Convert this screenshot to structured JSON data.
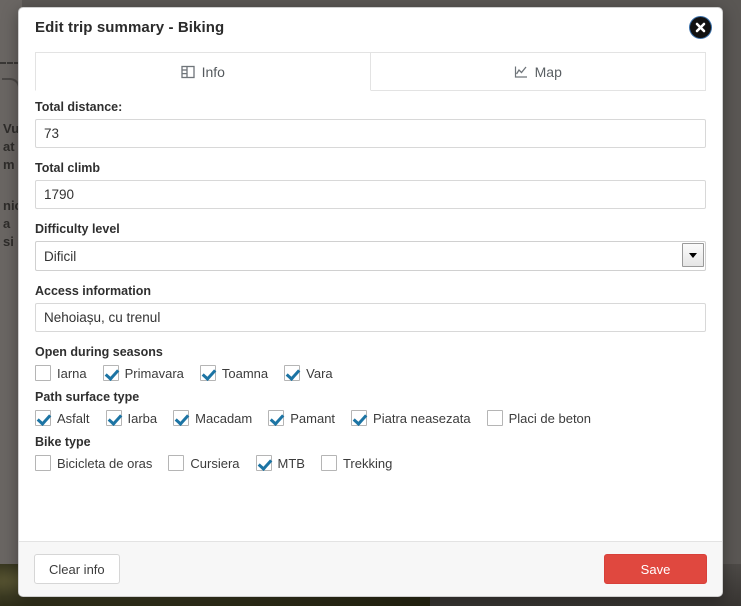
{
  "background": {
    "visible_text_fragments": [
      "Vu",
      "at",
      "m",
      "nic",
      "a",
      "si"
    ]
  },
  "modal": {
    "title": "Edit trip summary - Biking",
    "close_icon": "close-circle-icon",
    "tabs": [
      {
        "label": "Info",
        "icon": "info-list-icon",
        "active": true
      },
      {
        "label": "Map",
        "icon": "chart-line-icon",
        "active": false
      }
    ],
    "fields": [
      {
        "key": "total_distance",
        "label": "Total distance:",
        "type": "text",
        "value": "73",
        "placeholder": ""
      },
      {
        "key": "total_climb",
        "label": "Total climb",
        "type": "text",
        "value": "1790",
        "placeholder": ""
      },
      {
        "key": "difficulty_level",
        "label": "Difficulty level",
        "type": "select",
        "value": "Dificil",
        "options": [
          "Dificil"
        ]
      },
      {
        "key": "access_information",
        "label": "Access information",
        "type": "text",
        "value": "Nehoiașu, cu trenul",
        "placeholder": ""
      }
    ],
    "checkbox_sections": [
      {
        "key": "open_during_seasons",
        "label": "Open during seasons",
        "items": [
          {
            "label": "Iarna",
            "checked": false
          },
          {
            "label": "Primavara",
            "checked": true
          },
          {
            "label": "Toamna",
            "checked": true
          },
          {
            "label": "Vara",
            "checked": true
          }
        ]
      },
      {
        "key": "path_surface_type",
        "label": "Path surface type",
        "items": [
          {
            "label": "Asfalt",
            "checked": true
          },
          {
            "label": "Iarba",
            "checked": true
          },
          {
            "label": "Macadam",
            "checked": true
          },
          {
            "label": "Pamant",
            "checked": true
          },
          {
            "label": "Piatra neasezata",
            "checked": true
          },
          {
            "label": "Placi de beton",
            "checked": false
          }
        ]
      },
      {
        "key": "bike_type",
        "label": "Bike type",
        "items": [
          {
            "label": "Bicicleta de oras",
            "checked": false
          },
          {
            "label": "Cursiera",
            "checked": false
          },
          {
            "label": "MTB",
            "checked": true
          },
          {
            "label": "Trekking",
            "checked": false
          }
        ]
      }
    ],
    "footer": {
      "clear_label": "Clear info",
      "save_label": "Save"
    }
  },
  "colors": {
    "save_button": "#e0483f",
    "checkmark": "#1c74a4",
    "title_text": "#2b2b2b",
    "modal_background": "#ffffff",
    "footer_background": "#f7f7f7"
  }
}
